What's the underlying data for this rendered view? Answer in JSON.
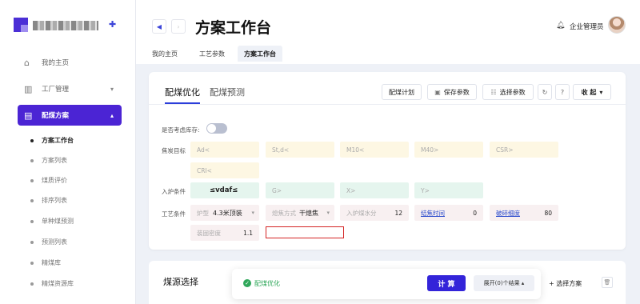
{
  "sidebar": {
    "pin_icon": "pin-icon",
    "items": [
      {
        "label": "我的主页",
        "icon": "home-icon"
      },
      {
        "label": "工厂管理",
        "icon": "factory-icon"
      },
      {
        "label": "配煤方案",
        "icon": "document-icon"
      }
    ],
    "sub_items": [
      "方案工作台",
      "方案列表",
      "煤质评价",
      "排序列表",
      "单种煤预测",
      "预测列表",
      "精煤库",
      "精煤资源库"
    ]
  },
  "header": {
    "title": "方案工作台",
    "user_name": "企业管理员",
    "tabs": [
      "我的主页",
      "工艺参数",
      "方案工作台"
    ]
  },
  "card": {
    "tabs": [
      "配煤优化",
      "配煤预测"
    ],
    "buttons": {
      "plan": "配煤计划",
      "save": "保存参数",
      "select": "选择参数",
      "collapse": "收 起"
    },
    "inventory_label": "是否考虑库存:",
    "coke_target_label": "焦炭目标",
    "coke_targets": [
      "Ad<",
      "St,d<",
      "M10<",
      "M40>",
      "CSR>",
      "CRI<"
    ],
    "furnace_label": "入炉条件",
    "furnace": [
      "≤vdaf≤",
      "G>",
      "X>",
      "Y>"
    ],
    "process_label": "工艺条件",
    "process": {
      "furnace_type_label": "炉型",
      "furnace_type_value": "4.3米顶装",
      "quench_label": "熄焦方式",
      "quench_value": "干熄焦",
      "moisture_label": "入炉煤水分",
      "moisture_value": "12",
      "coking_time_label": "结焦时间",
      "coking_time_value": "0",
      "crush_label": "破碎细度",
      "crush_value": "80",
      "bulk_label": "装固密度",
      "bulk_value": "1.1"
    }
  },
  "card2": {
    "title": "煤源选择",
    "add_button": "+ 选择方案"
  },
  "float_bar": {
    "status": "配煤优化",
    "calc_button": "计 算",
    "expand_button": "展开(0)个结果 ▴"
  },
  "colors": {
    "primary": "#4b24d4",
    "button": "#3324d9",
    "success": "#2fa75a",
    "highlight": "#d42424"
  }
}
